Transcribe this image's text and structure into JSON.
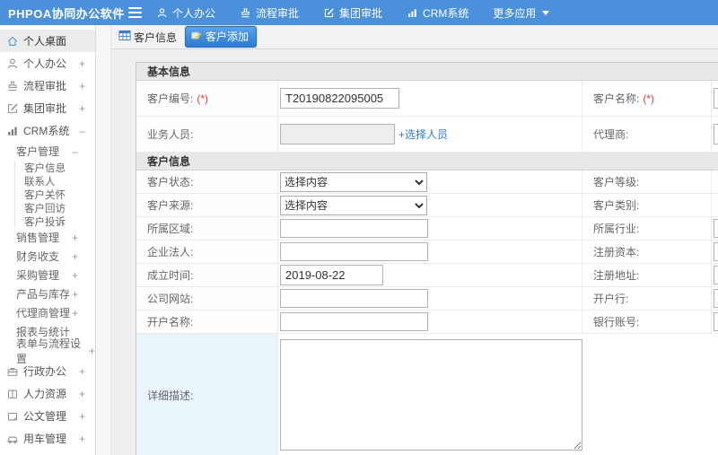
{
  "colors": {
    "header_blue": "#4a90db",
    "active_tab_blue": "#2c7ad2",
    "required_red": "#e03c3c",
    "link_blue": "#2d7bd4"
  },
  "header": {
    "logo": "PHPOA协同办公软件",
    "nav": [
      {
        "label": "个人办公"
      },
      {
        "label": "流程审批"
      },
      {
        "label": "集团审批"
      },
      {
        "label": "CRM系统"
      },
      {
        "label": "更多应用"
      }
    ]
  },
  "sidebar": {
    "items": [
      {
        "label": "个人桌面",
        "expand": ""
      },
      {
        "label": "个人办公",
        "expand": "+"
      },
      {
        "label": "流程审批",
        "expand": "+"
      },
      {
        "label": "集团审批",
        "expand": "+"
      },
      {
        "label": "CRM系统",
        "expand": "–"
      },
      {
        "label": "客户管理",
        "expand": "–"
      },
      {
        "label": "客户信息",
        "expand": ""
      },
      {
        "label": "联系人",
        "expand": ""
      },
      {
        "label": "客户关怀",
        "expand": ""
      },
      {
        "label": "客户回访",
        "expand": ""
      },
      {
        "label": "客户投诉",
        "expand": ""
      },
      {
        "label": "销售管理",
        "expand": "+"
      },
      {
        "label": "财务收支",
        "expand": "+"
      },
      {
        "label": "采购管理",
        "expand": "+"
      },
      {
        "label": "产品与库存",
        "expand": "+"
      },
      {
        "label": "代理商管理",
        "expand": "+"
      },
      {
        "label": "报表与统计",
        "expand": ""
      },
      {
        "label": "表单与流程设置",
        "expand": "+"
      },
      {
        "label": "行政办公",
        "expand": "+"
      },
      {
        "label": "人力资源",
        "expand": "+"
      },
      {
        "label": "公文管理",
        "expand": "+"
      },
      {
        "label": "用车管理",
        "expand": "+"
      }
    ]
  },
  "tabs": {
    "info": "客户信息",
    "add": "客户添加"
  },
  "form": {
    "sections": {
      "basic": {
        "title": "基本信息",
        "rows": [
          {
            "l": "客户编号:",
            "lreq": "(*)",
            "value": "T20190822095005",
            "r": "客户名称:",
            "rreq": "(*)"
          },
          {
            "l": "业务人员:",
            "link": "+选择人员",
            "r": "代理商:"
          }
        ]
      },
      "customer": {
        "title": "客户信息",
        "rows": [
          {
            "l": "客户状态:",
            "select": "选择内容",
            "r": "客户等级:"
          },
          {
            "l": "客户来源:",
            "select": "选择内容",
            "r": "客户类别:"
          },
          {
            "l": "所属区域:",
            "r": "所属行业:"
          },
          {
            "l": "企业法人:",
            "r": "注册资本:"
          },
          {
            "l": "成立时间:",
            "value": "2019-08-22",
            "r": "注册地址:"
          },
          {
            "l": "公司网站:",
            "r": "开户行:"
          },
          {
            "l": "开户名称:",
            "r": "银行账号:"
          },
          {
            "l": "详细描述:"
          }
        ]
      }
    }
  }
}
